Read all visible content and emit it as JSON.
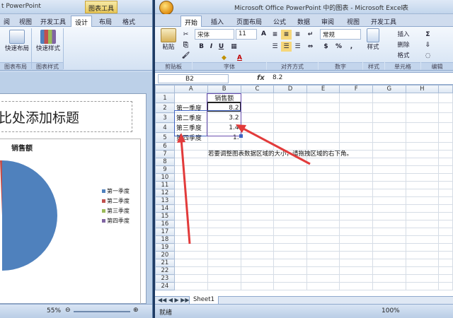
{
  "ppt": {
    "title": "图表工具",
    "app_title": "t PowerPoint",
    "tabs": [
      "阅",
      "视图",
      "开发工具",
      "设计",
      "布局",
      "格式"
    ],
    "ribbon": {
      "quick_layout": "快速布局",
      "quick_style": "快速样式",
      "group_layouts": "图表布局",
      "group_styles": "图表样式"
    },
    "slide": {
      "title_placeholder": "比处添加标题",
      "chart_title": "销售额",
      "legend": [
        "第一季度",
        "第二季度",
        "第三季度",
        "第四季度"
      ]
    },
    "status": {
      "zoom": "55%"
    }
  },
  "excel": {
    "title": "Microsoft Office PowerPoint 中的图表 - Microsoft Excel",
    "title_extra": "表",
    "tabs": [
      "开始",
      "插入",
      "页面布局",
      "公式",
      "数据",
      "审阅",
      "视图",
      "开发工具"
    ],
    "font_name": "宋体",
    "font_size": "11",
    "number_format": "常规",
    "groups": [
      "剪贴板",
      "字体",
      "对齐方式",
      "数字",
      "样式",
      "单元格",
      "编辑"
    ],
    "buttons": {
      "paste": "粘贴",
      "style": "样式",
      "insert": "插入",
      "delete": "删除",
      "format": "格式"
    },
    "name_box": "B2",
    "formula_value": "8.2",
    "fx_label": "fx",
    "columns": [
      "A",
      "B",
      "C",
      "D",
      "E",
      "F",
      "G",
      "H"
    ],
    "rows": [
      {
        "n": "1",
        "a": "",
        "b": "销售额"
      },
      {
        "n": "2",
        "a": "第一季度",
        "b": "8.2"
      },
      {
        "n": "3",
        "a": "第二季度",
        "b": "3.2"
      },
      {
        "n": "4",
        "a": "第三季度",
        "b": "1.4"
      },
      {
        "n": "5",
        "a": "第四季度",
        "b": "1."
      },
      {
        "n": "6",
        "a": "",
        "b": ""
      },
      {
        "n": "7",
        "a": "",
        "b": ""
      },
      {
        "n": "8",
        "a": "",
        "b": ""
      },
      {
        "n": "9",
        "a": "",
        "b": ""
      },
      {
        "n": "10",
        "a": "",
        "b": ""
      },
      {
        "n": "11",
        "a": "",
        "b": ""
      },
      {
        "n": "12",
        "a": "",
        "b": ""
      },
      {
        "n": "13",
        "a": "",
        "b": ""
      },
      {
        "n": "14",
        "a": "",
        "b": ""
      },
      {
        "n": "15",
        "a": "",
        "b": ""
      },
      {
        "n": "16",
        "a": "",
        "b": ""
      },
      {
        "n": "17",
        "a": "",
        "b": ""
      },
      {
        "n": "18",
        "a": "",
        "b": ""
      },
      {
        "n": "19",
        "a": "",
        "b": ""
      },
      {
        "n": "20",
        "a": "",
        "b": ""
      },
      {
        "n": "21",
        "a": "",
        "b": ""
      },
      {
        "n": "22",
        "a": "",
        "b": ""
      },
      {
        "n": "23",
        "a": "",
        "b": ""
      },
      {
        "n": "24",
        "a": "",
        "b": ""
      }
    ],
    "note": "若要调整图表数据区域的大小，请拖拽区域的右下角。",
    "sheet_tab": "Sheet1",
    "status_ready": "就绪",
    "status_zoom": "100%"
  },
  "colors": {
    "pie_blue": "#4f81bd",
    "pie_red": "#c0504d",
    "pie_green": "#9bbb59",
    "pie_purple": "#8064a2",
    "arrow": "#e23b3b"
  }
}
